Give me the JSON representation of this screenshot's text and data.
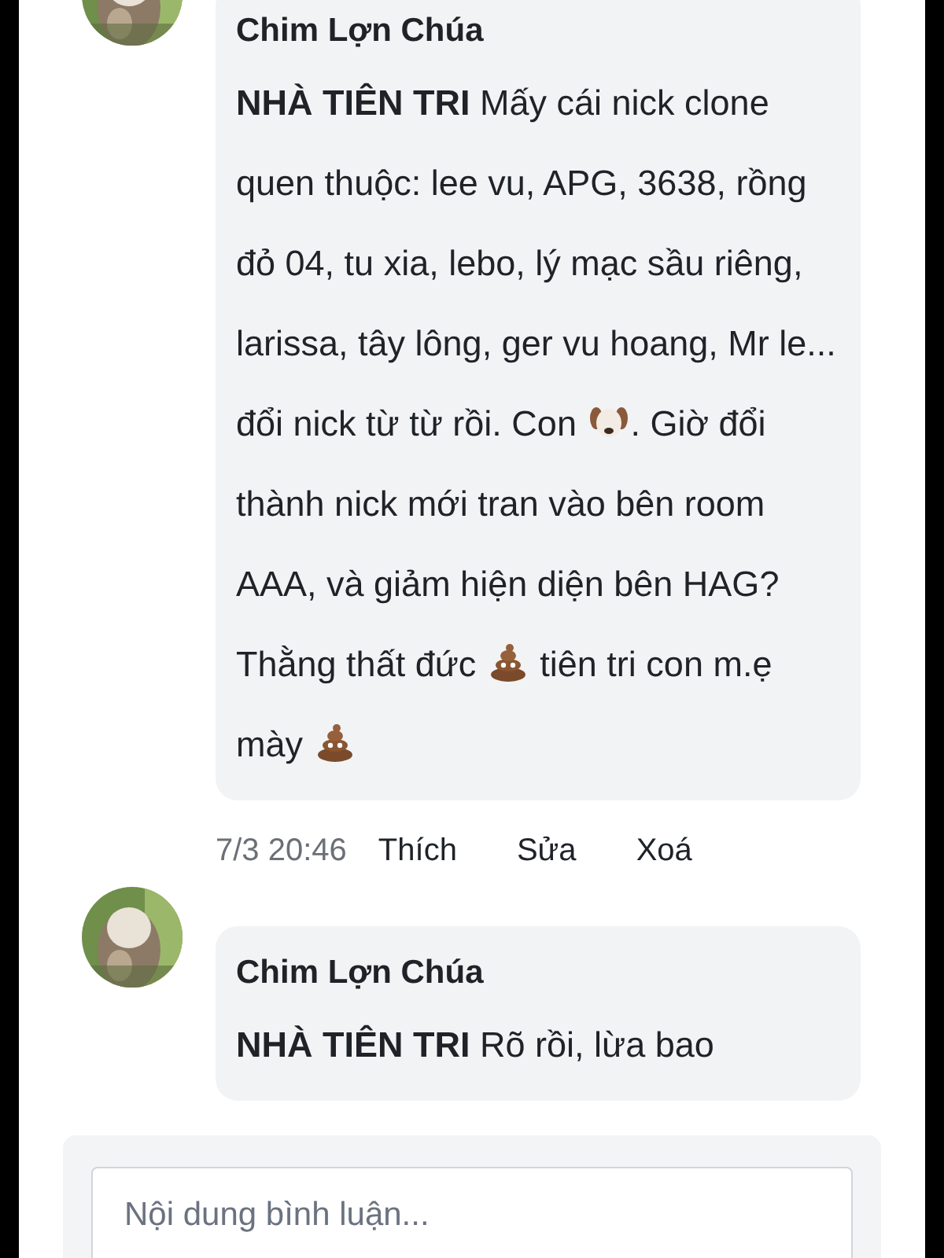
{
  "comments": [
    {
      "author": "Chim Lợn Chúa",
      "badge": "NHÀ TIÊN TRI",
      "body": [
        {
          "kind": "text",
          "text": "Mấy cái nick clone quen thuộc: lee vu, APG, 3638, rồng đỏ 04, tu xia, lebo, lý mạc sầu riêng, larissa, tây lông, ger vu hoang, Mr le... đổi nick từ từ rồi. Con "
        },
        {
          "kind": "dog"
        },
        {
          "kind": "text",
          "text": ". Giờ đổi thành nick mới tran vào bên room AAA, và giảm hiện diện bên HAG? Thằng thất đức "
        },
        {
          "kind": "poop"
        },
        {
          "kind": "text",
          "text": " tiên tri con m.ẹ mày "
        },
        {
          "kind": "poop"
        }
      ],
      "time": "7/3 20:46",
      "actions": [
        "Thích",
        "Sửa",
        "Xoá"
      ]
    },
    {
      "author": "Chim Lợn Chúa",
      "badge": "NHÀ TIÊN TRI",
      "body": [
        {
          "kind": "text",
          "text": "Rõ rồi, lừa bao"
        }
      ]
    }
  ],
  "composer": {
    "placeholder": "Nội dung bình luận..."
  }
}
